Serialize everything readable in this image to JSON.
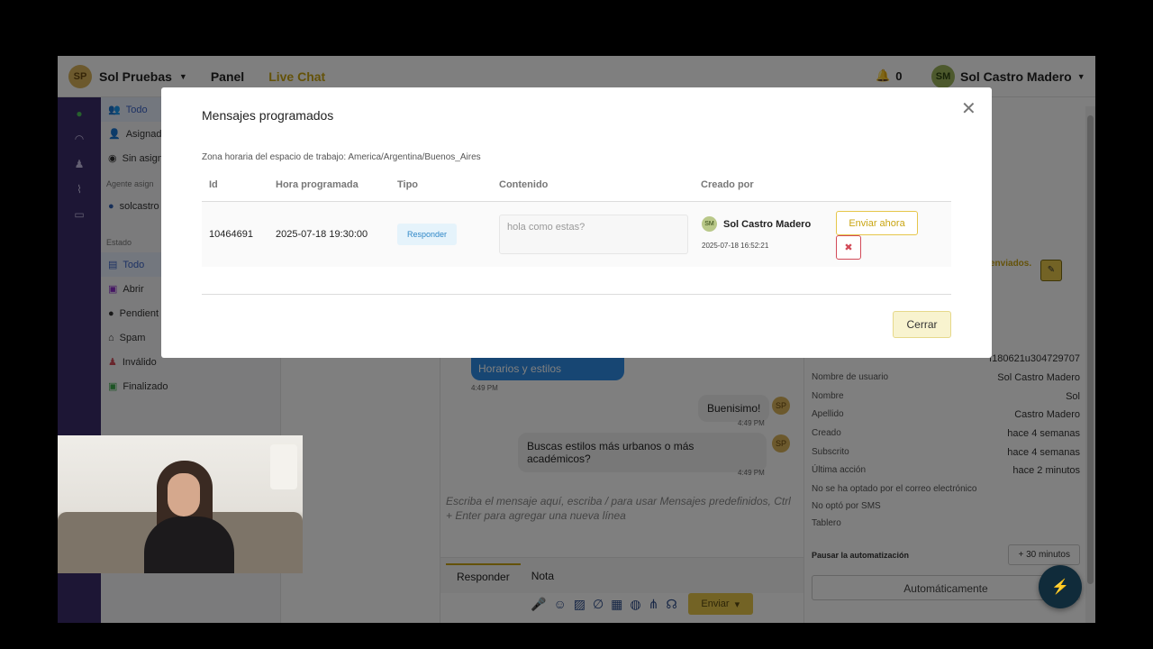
{
  "topbar": {
    "workspace_initials": "SP",
    "workspace_name": "Sol Pruebas",
    "nav_panel": "Panel",
    "nav_live": "Live Chat",
    "notifications": "0",
    "user_initials": "SM",
    "user_name": "Sol Castro Madero"
  },
  "sidebar": {
    "items_top": [
      {
        "label": "Todo"
      },
      {
        "label": "Asignado"
      },
      {
        "label": "Sin asign"
      }
    ],
    "section_agent": "Agente asign",
    "agent_name": "solcastro",
    "section_estado": "Estado",
    "items_estado": [
      {
        "label": "Todo"
      },
      {
        "label": "Abrir"
      },
      {
        "label": "Pendient"
      },
      {
        "label": "Spam"
      },
      {
        "label": "Inválido"
      },
      {
        "label": "Finalizado"
      }
    ]
  },
  "chat": {
    "bubble_blue": "Horarios y estilos",
    "time1": "4:49 PM",
    "msg1": "Buenisimo!",
    "time2": "4:49 PM",
    "msg2": "Buscas estilos más urbanos o más académicos?",
    "time3": "4:49 PM",
    "sp_initials": "SP",
    "composer_placeholder": "Escriba el mensaje aquí, escriba / para usar Mensajes predefinidos, Ctrl + Enter para agregar una nueva línea",
    "tab_reply": "Responder",
    "tab_note": "Nota",
    "send_label": "Enviar"
  },
  "right_panel": {
    "warn_text": "enviados.",
    "fields": [
      {
        "k": "",
        "v": "f180621u304729707"
      },
      {
        "k": "Nombre de usuario",
        "v": "Sol Castro Madero"
      },
      {
        "k": "Nombre",
        "v": "Sol"
      },
      {
        "k": "Apellido",
        "v": "Castro Madero"
      },
      {
        "k": "Creado",
        "v": "hace 4 semanas"
      },
      {
        "k": "Subscrito",
        "v": "hace 4 semanas"
      },
      {
        "k": "Última acción",
        "v": "hace 2 minutos"
      }
    ],
    "note_email": "No se ha optado por el correo electrónico",
    "note_sms": "No optó por SMS",
    "tablero": "Tablero",
    "pause_label": "Pausar la automatización",
    "pause_value": "+ 30 minutos",
    "auto_label": "Automáticamente"
  },
  "modal": {
    "title": "Mensajes programados",
    "timezone": "Zona horaria del espacio de trabajo: America/Argentina/Buenos_Aires",
    "headers": {
      "id": "Id",
      "hora": "Hora programada",
      "tipo": "Tipo",
      "contenido": "Contenido",
      "creado": "Creado por"
    },
    "row": {
      "id": "10464691",
      "hora": "2025-07-18 19:30:00",
      "tipo": "Responder",
      "contenido": "hola como estas?",
      "creado_initials": "SM",
      "creado_nombre": "Sol Castro Madero",
      "creado_fecha": "2025-07-18 16:52:21"
    },
    "send_now": "Enviar ahora",
    "close": "Cerrar"
  },
  "colors": {
    "accent": "#c9a512",
    "sidebar_dark": "#3b2c6b",
    "badge": "#2f87c7",
    "danger": "#d24a58"
  }
}
